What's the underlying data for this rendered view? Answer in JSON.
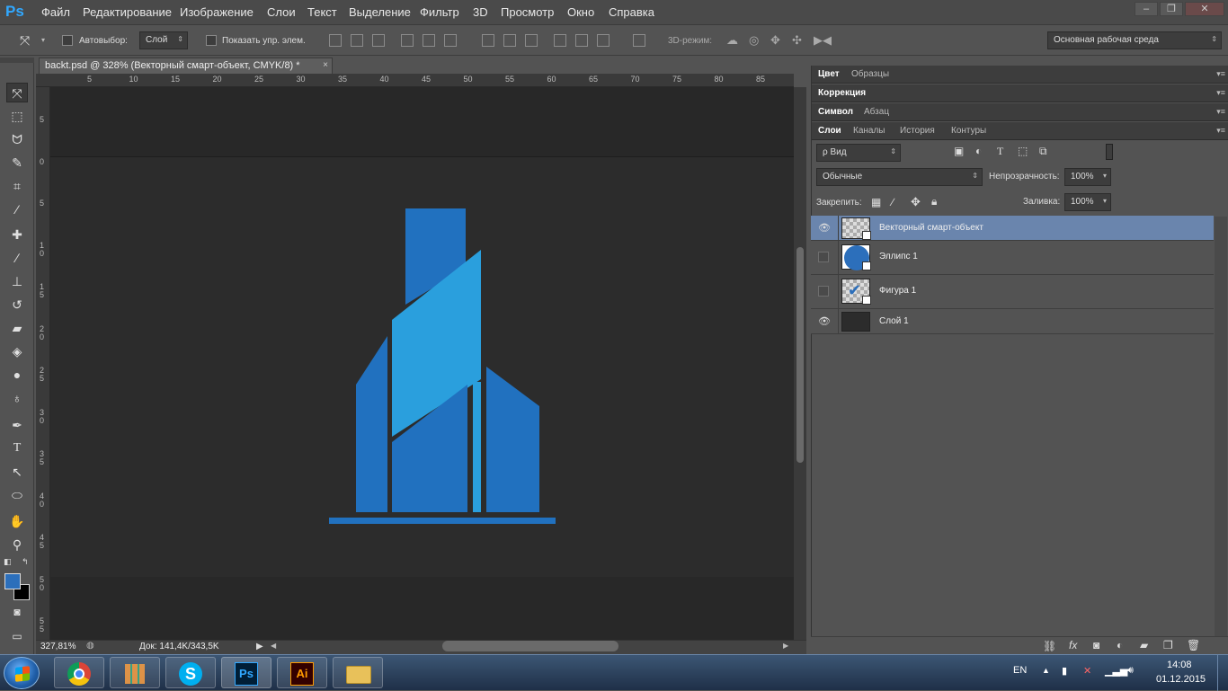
{
  "app": {
    "logo": "Ps"
  },
  "menu": [
    "Файл",
    "Редактирование",
    "Изображение",
    "Слои",
    "Текст",
    "Выделение",
    "Фильтр",
    "3D",
    "Просмотр",
    "Окно",
    "Справка"
  ],
  "window_controls": {
    "minimize": "–",
    "restore": "❐",
    "close": "✕"
  },
  "options": {
    "autoselect_label": "Автовыбор:",
    "autoselect_value": "Слой",
    "show_controls_label": "Показать упр. элем.",
    "mode3d_label": "3D-режим:",
    "workspace": "Основная рабочая среда"
  },
  "document": {
    "tab_title": "backt.psd @ 328% (Векторный смарт-объект, CMYK/8) *",
    "tab_close": "×"
  },
  "ruler_h": [
    "5",
    "10",
    "15",
    "20",
    "25",
    "30",
    "35",
    "40",
    "45",
    "50",
    "55",
    "60",
    "65",
    "70",
    "75",
    "80",
    "85"
  ],
  "ruler_v": [
    "5",
    "0",
    "5",
    "1\n0",
    "1\n5",
    "2\n0",
    "2\n5",
    "3\n0",
    "3\n5",
    "4\n0",
    "4\n5",
    "5\n0",
    "5\n5"
  ],
  "status": {
    "zoom": "327,81%",
    "doc": "Док: 141,4K/343,5K"
  },
  "panels": {
    "row1": [
      "Цвет",
      "Образцы"
    ],
    "row2": [
      "Коррекция"
    ],
    "row3": [
      "Символ",
      "Абзац"
    ],
    "row4": [
      "Слои",
      "Каналы",
      "История",
      "Контуры"
    ]
  },
  "layers_panel": {
    "filter_label": "ρ Вид",
    "blend_mode": "Обычные",
    "opacity_label": "Непрозрачность:",
    "opacity_value": "100%",
    "lock_label": "Закрепить:",
    "fill_label": "Заливка:",
    "fill_value": "100%"
  },
  "layers": [
    {
      "name": "Векторный смарт-объект",
      "visible": true,
      "selected": true
    },
    {
      "name": "Эллипс 1",
      "visible": false,
      "selected": false
    },
    {
      "name": "Фигура 1",
      "visible": false,
      "selected": false
    },
    {
      "name": "Слой 1",
      "visible": true,
      "selected": false
    }
  ],
  "taskbar": {
    "apps": [
      "chrome",
      "apps-grid",
      "skype",
      "photoshop",
      "illustrator",
      "explorer"
    ],
    "ps_label": "Ps",
    "ai_label": "Ai",
    "lang": "EN",
    "time": "14:08",
    "date": "01.12.2015"
  },
  "colors": {
    "accent": "#31a8ff",
    "logo_dark": "#2171bf",
    "logo_light": "#2a9fdd",
    "selected_layer": "#6a85ad",
    "foreground": "#2c6fbb",
    "background": "#000000"
  }
}
